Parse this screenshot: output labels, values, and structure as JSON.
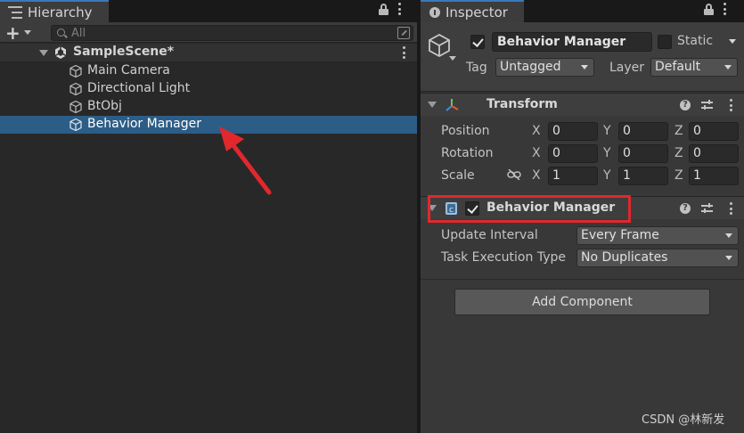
{
  "hierarchy": {
    "tab_label": "Hierarchy",
    "search": {
      "placeholder": "All"
    },
    "scene": {
      "name": "SampleScene*"
    },
    "items": [
      {
        "label": "Main Camera"
      },
      {
        "label": "Directional Light"
      },
      {
        "label": "BtObj"
      },
      {
        "label": "Behavior Manager",
        "selected": true
      }
    ]
  },
  "inspector": {
    "tab_label": "Inspector",
    "object": {
      "name": "Behavior Manager",
      "active": true,
      "static_label": "Static",
      "tag_label": "Tag",
      "tag_value": "Untagged",
      "layer_label": "Layer",
      "layer_value": "Default"
    },
    "transform": {
      "title": "Transform",
      "position_label": "Position",
      "rotation_label": "Rotation",
      "scale_label": "Scale",
      "axis_x": "X",
      "axis_y": "Y",
      "axis_z": "Z",
      "position": {
        "x": "0",
        "y": "0",
        "z": "0"
      },
      "rotation": {
        "x": "0",
        "y": "0",
        "z": "0"
      },
      "scale": {
        "x": "1",
        "y": "1",
        "z": "1"
      }
    },
    "behavior_manager": {
      "title": "Behavior Manager",
      "enabled": true,
      "update_interval_label": "Update Interval",
      "update_interval_value": "Every Frame",
      "task_execution_label": "Task Execution Type",
      "task_execution_value": "No Duplicates"
    },
    "add_component_label": "Add Component"
  },
  "annotations": {
    "arrow_color": "#e0282d",
    "highlight_color": "#e0282d"
  },
  "watermark": "CSDN @林新发",
  "colors": {
    "selection": "#2c5d87",
    "tab_accent": "#3a79bb"
  }
}
